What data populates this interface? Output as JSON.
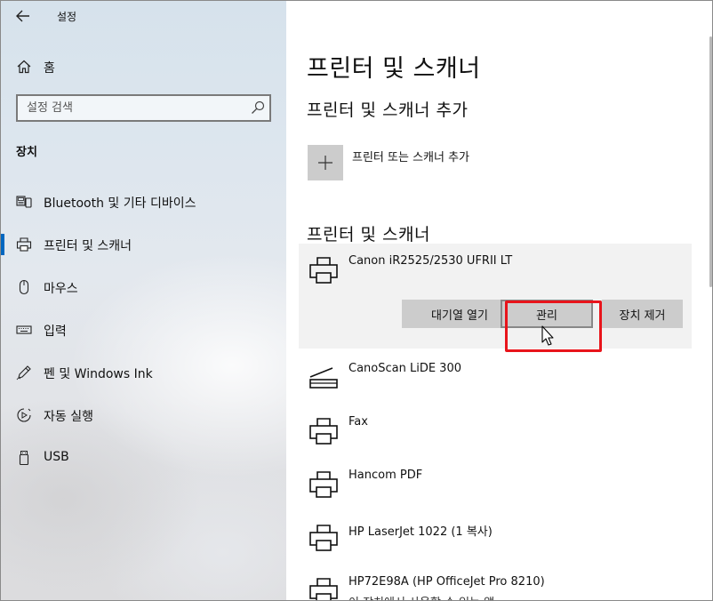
{
  "window": {
    "app_title": "설정",
    "back_icon": "back-arrow-icon",
    "controls": [
      "minimize-icon",
      "maximize-icon",
      "close-icon"
    ],
    "extra_icon": "tablet-mode-icon"
  },
  "sidebar": {
    "home_label": "홈",
    "search_placeholder": "설정 검색",
    "section_label": "장치",
    "items": [
      {
        "label": "Bluetooth 및 기타 디바이스",
        "icon": "bluetooth-devices-icon",
        "active": false
      },
      {
        "label": "프린터 및 스캐너",
        "icon": "printer-icon",
        "active": true
      },
      {
        "label": "마우스",
        "icon": "mouse-icon",
        "active": false
      },
      {
        "label": "입력",
        "icon": "keyboard-icon",
        "active": false
      },
      {
        "label": "펜 및 Windows Ink",
        "icon": "pen-icon",
        "active": false
      },
      {
        "label": "자동 실행",
        "icon": "autoplay-icon",
        "active": false
      },
      {
        "label": "USB",
        "icon": "usb-icon",
        "active": false
      }
    ]
  },
  "main": {
    "page_title": "프린터 및 스캐너",
    "add_section_title": "프린터 및 스캐너 추가",
    "add_button_label": "프린터 또는 스캐너 추가",
    "list_section_title": "프린터 및 스캐너",
    "selected_printer": {
      "name": "Canon iR2525/2530 UFRII LT",
      "buttons": {
        "queue": "대기열 열기",
        "manage": "관리",
        "remove": "장치 제거"
      }
    },
    "printers": [
      {
        "name": "CanoScan LiDE 300",
        "icon": "scanner-icon",
        "sub": ""
      },
      {
        "name": "Fax",
        "icon": "printer-icon",
        "sub": ""
      },
      {
        "name": "Hancom PDF",
        "icon": "printer-icon",
        "sub": ""
      },
      {
        "name": "HP LaserJet 1022 (1 복사)",
        "icon": "printer-icon",
        "sub": ""
      },
      {
        "name": "HP72E98A (HP OfficeJet Pro 8210)",
        "icon": "printer-icon",
        "sub": "이 장치에서 사용할 수 있는 앱"
      }
    ]
  },
  "colors": {
    "accent": "#0067c0",
    "highlight": "#e8141b",
    "button": "#cccccc",
    "card": "#f2f2f2"
  }
}
